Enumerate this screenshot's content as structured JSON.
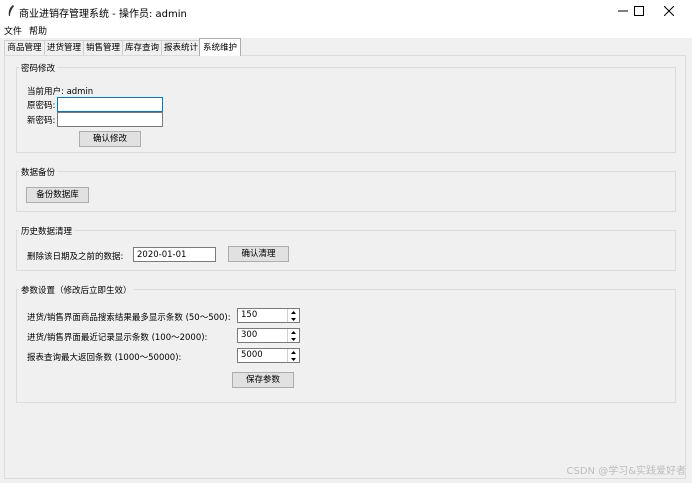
{
  "window": {
    "title": "商业进销存管理系统 - 操作员: admin",
    "icon": "feather-icon",
    "controls": [
      "minimize-icon",
      "maximize-icon",
      "close-icon"
    ]
  },
  "menu": [
    "文件",
    "帮助"
  ],
  "tabs": [
    "商品管理",
    "进货管理",
    "销售管理",
    "库存查询",
    "报表统计",
    "系统维护"
  ],
  "active_tab": "系统维护",
  "password": {
    "legend": "密码修改",
    "current_user_label": "当前用户: admin",
    "old_label": "原密码:",
    "new_label": "新密码:",
    "old_value": "",
    "new_value": "",
    "confirm_button": "确认修改"
  },
  "backup": {
    "legend": "数据备份",
    "button": "备份数据库"
  },
  "cleanup": {
    "legend": "历史数据清理",
    "label": "删除该日期及之前的数据:",
    "date_value": "2020-01-01",
    "button": "确认清理"
  },
  "params": {
    "legend": "参数设置（修改后立即生效）",
    "rows": [
      {
        "label": "进货/销售界面商品搜索结果最多显示条数 (50～500):",
        "value": "150"
      },
      {
        "label": "进货/销售界面最近记录显示条数 (100～2000):",
        "value": "300"
      },
      {
        "label": "报表查询最大返回条数 (1000～50000):",
        "value": "5000"
      }
    ],
    "save_button": "保存参数"
  },
  "watermark": "CSDN @学习&实践爱好者",
  "colors": {
    "focus_border": "#0078d7",
    "button_bg": "#e1e1e1",
    "window_bg": "#f0f0f0"
  }
}
